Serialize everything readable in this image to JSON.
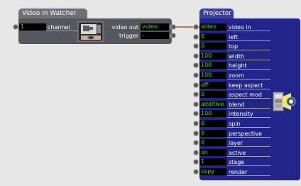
{
  "watcher": {
    "title": "Video In Watcher",
    "inputs": [
      {
        "label": "channel",
        "value": "1"
      }
    ],
    "outputs": [
      {
        "label": "video out",
        "value": "video"
      },
      {
        "label": "trigger",
        "value": "-"
      }
    ],
    "icon": "camera-monitor-icon"
  },
  "projector": {
    "title": "Projector",
    "icon": "projector-lamp-icon",
    "inputs": [
      {
        "label": "video in",
        "value": "video"
      },
      {
        "label": "left",
        "value": "0"
      },
      {
        "label": "top",
        "value": "0"
      },
      {
        "label": "width",
        "value": "100"
      },
      {
        "label": "height",
        "value": "100"
      },
      {
        "label": "zoom",
        "value": "100"
      },
      {
        "label": "keep aspect",
        "value": "off"
      },
      {
        "label": "aspect mod",
        "value": "0"
      },
      {
        "label": "blend",
        "value": "additive"
      },
      {
        "label": "intensity",
        "value": "100"
      },
      {
        "label": "spin",
        "value": "0"
      },
      {
        "label": "perspective",
        "value": "0"
      },
      {
        "label": "layer",
        "value": "0"
      },
      {
        "label": "active",
        "value": "on"
      },
      {
        "label": "stage",
        "value": "1"
      },
      {
        "label": "render",
        "value": "copy"
      }
    ]
  },
  "colors": {
    "canvas": "#e6e6e6",
    "watcher_body": "#56565e",
    "watcher_title": "#6f6f76",
    "projector_body": "#22268a",
    "projector_title": "#3a3e9c",
    "value_text": "#35e23a",
    "cable": "#c84a3f"
  }
}
